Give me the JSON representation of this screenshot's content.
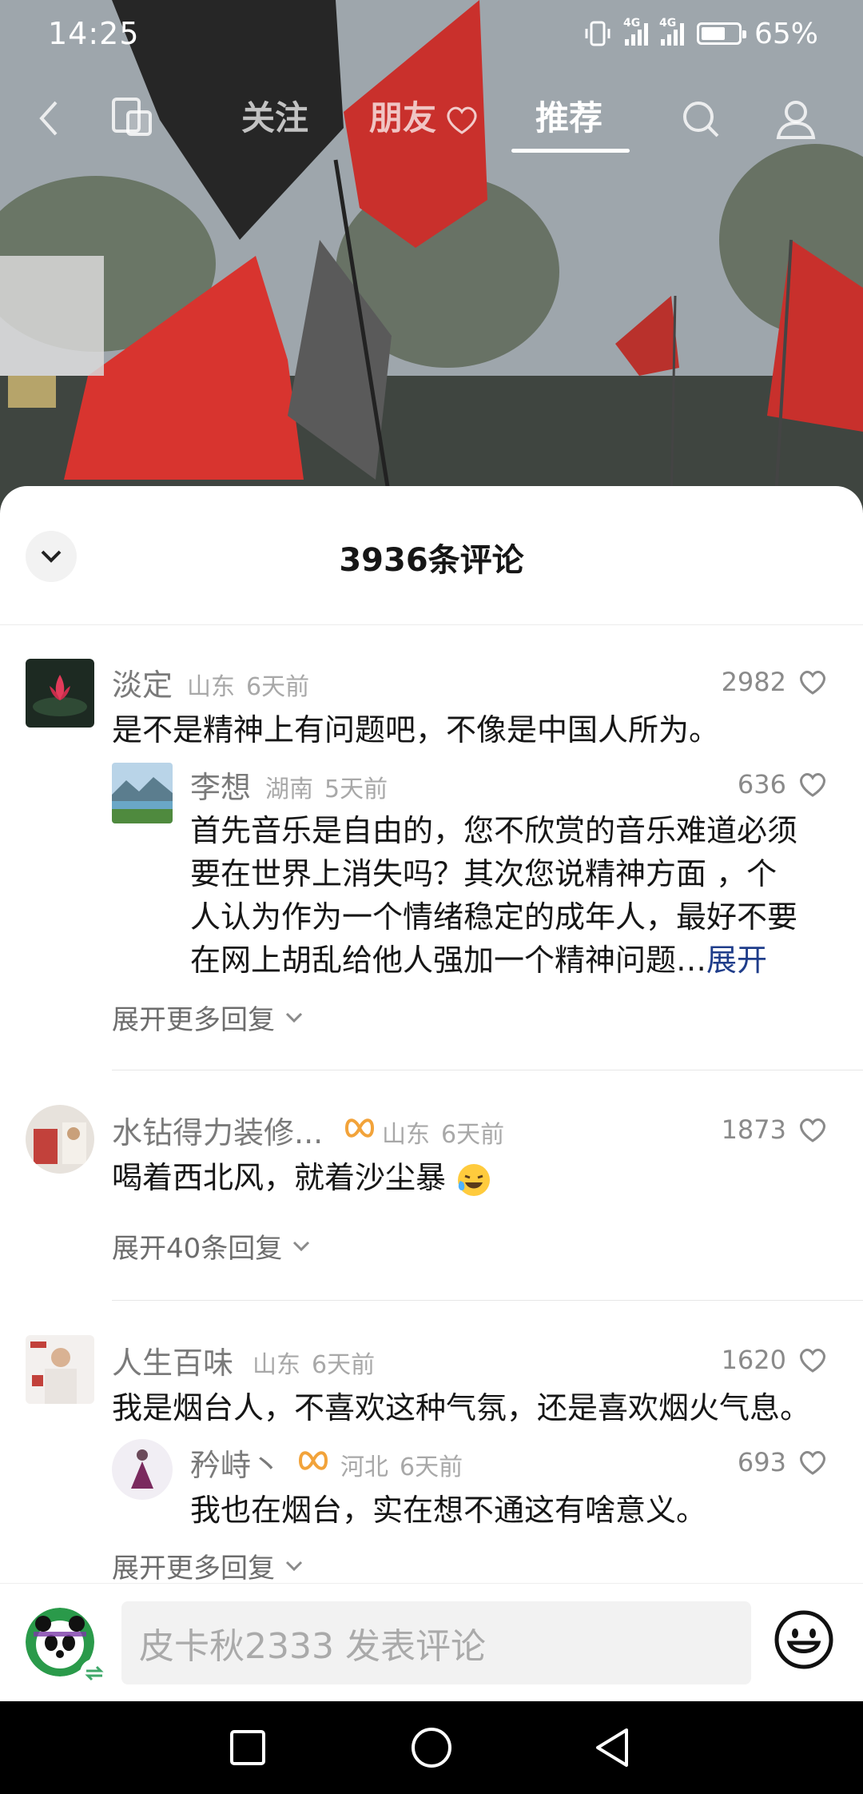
{
  "status_bar": {
    "time": "14:25",
    "signal_1": "4G",
    "signal_2": "4G",
    "battery": "65%",
    "battery_level": 0.65
  },
  "top_nav": {
    "tabs": [
      {
        "label": "关注"
      },
      {
        "label": "朋友"
      },
      {
        "label": "推荐",
        "active": true
      }
    ]
  },
  "comments_panel": {
    "count_title": "3936条评论",
    "comments": [
      {
        "name": "淡定",
        "location": "山东",
        "time": "6天前",
        "likes": "2982",
        "text": "是不是精神上有问题吧，不像是中国人所为。",
        "reply": {
          "name": "李想",
          "location": "湖南",
          "time": "5天前",
          "likes": "636",
          "lines": [
            "首先音乐是自由的，您不欣赏的音乐难道必须",
            "要在世界上消失吗？其次您说精神方面 ，个",
            "人认为作为一个情绪稳定的成年人，最好不要",
            "在网上胡乱给他人强加一个精神问题…"
          ],
          "expand_label": "展开"
        },
        "more_replies": "展开更多回复"
      },
      {
        "name": "水钻得力装修...",
        "location": "山东",
        "time": "6天前",
        "likes": "1873",
        "text": "喝着西北风，就着沙尘暴",
        "more_replies": "展开40条回复"
      },
      {
        "name": "人生百味",
        "location": "山东",
        "time": "6天前",
        "likes": "1620",
        "text": "我是烟台人，不喜欢这种气氛，还是喜欢烟火气息。",
        "reply": {
          "name": "矜峙丶",
          "location": "河北",
          "time": "6天前",
          "likes": "693",
          "text": "我也在烟台，实在想不通这有啥意义。"
        },
        "more_replies": "展开更多回复"
      }
    ]
  },
  "input_bar": {
    "placeholder": "皮卡秋2333 发表评论"
  },
  "colors": {
    "link_blue": "#1f3d8a",
    "badge_orange": "#f2a33a",
    "flag_red": "#d83a36"
  }
}
